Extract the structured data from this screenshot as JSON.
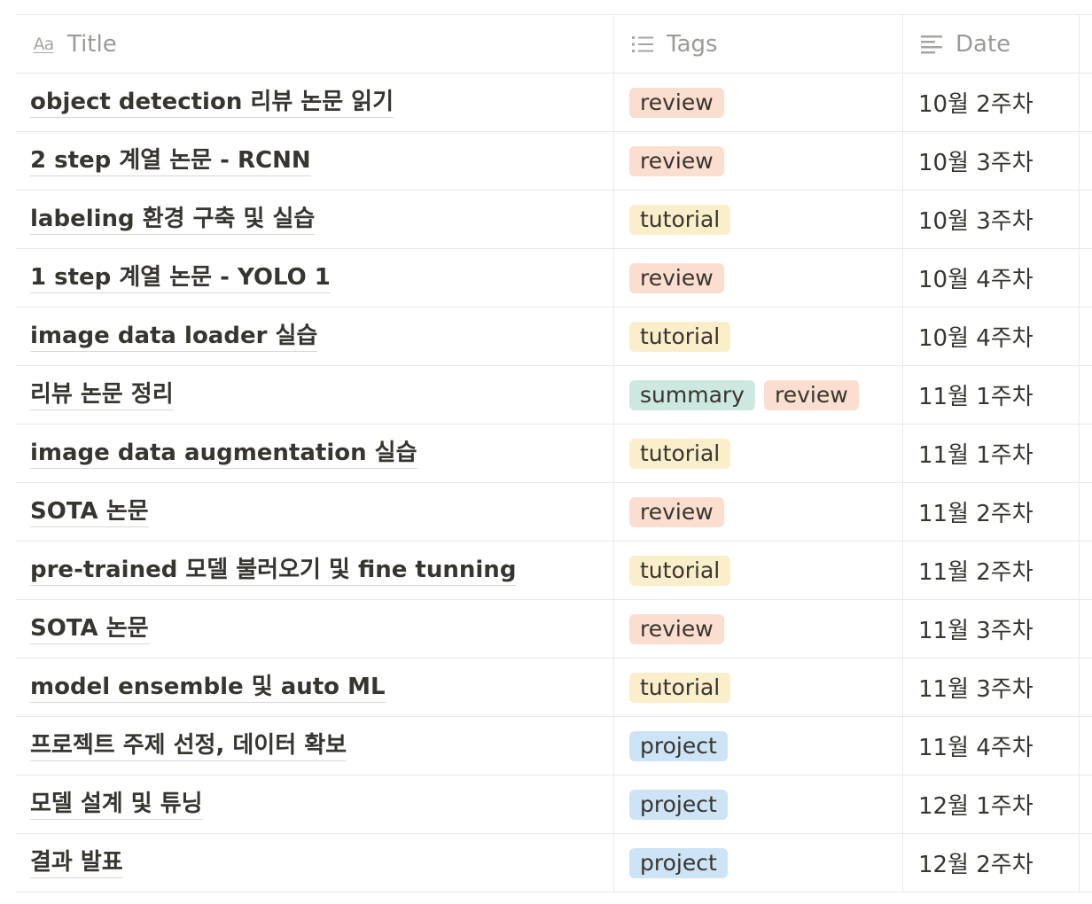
{
  "columns": {
    "title": "Title",
    "tags": "Tags",
    "date": "Date"
  },
  "icons": {
    "title_column": "Aa",
    "tags_column": "list-icon",
    "date_column": "text-lines-icon"
  },
  "tag_colors": {
    "review": "#fbdecf",
    "tutorial": "#fbeecb",
    "summary": "#cde8e1",
    "project": "#cde3f6"
  },
  "rows": [
    {
      "title": "object detection 리뷰 논문 읽기",
      "tags": [
        "review"
      ],
      "date": "10월 2주차"
    },
    {
      "title": "2 step 계열 논문 - RCNN",
      "tags": [
        "review"
      ],
      "date": "10월 3주차"
    },
    {
      "title": "labeling 환경 구축 및 실습",
      "tags": [
        "tutorial"
      ],
      "date": "10월 3주차"
    },
    {
      "title": "1 step 계열 논문 - YOLO 1",
      "tags": [
        "review"
      ],
      "date": "10월 4주차"
    },
    {
      "title": "image data loader 실습",
      "tags": [
        "tutorial"
      ],
      "date": "10월 4주차"
    },
    {
      "title": "리뷰 논문 정리",
      "tags": [
        "summary",
        "review"
      ],
      "date": "11월 1주차"
    },
    {
      "title": "image data augmentation 실습",
      "tags": [
        "tutorial"
      ],
      "date": "11월 1주차"
    },
    {
      "title": "SOTA 논문",
      "tags": [
        "review"
      ],
      "date": "11월 2주차"
    },
    {
      "title": "pre-trained 모델 불러오기 및 fine tunning",
      "tags": [
        "tutorial"
      ],
      "date": "11월 2주차"
    },
    {
      "title": "SOTA 논문",
      "tags": [
        "review"
      ],
      "date": "11월 3주차"
    },
    {
      "title": "model ensemble 및 auto ML",
      "tags": [
        "tutorial"
      ],
      "date": "11월 3주차"
    },
    {
      "title": "프로젝트 주제 선정, 데이터 확보",
      "tags": [
        "project"
      ],
      "date": "11월 4주차"
    },
    {
      "title": "모델 설계 및 튜닝",
      "tags": [
        "project"
      ],
      "date": "12월 1주차"
    },
    {
      "title": "결과 발표",
      "tags": [
        "project"
      ],
      "date": "12월 2주차"
    }
  ]
}
